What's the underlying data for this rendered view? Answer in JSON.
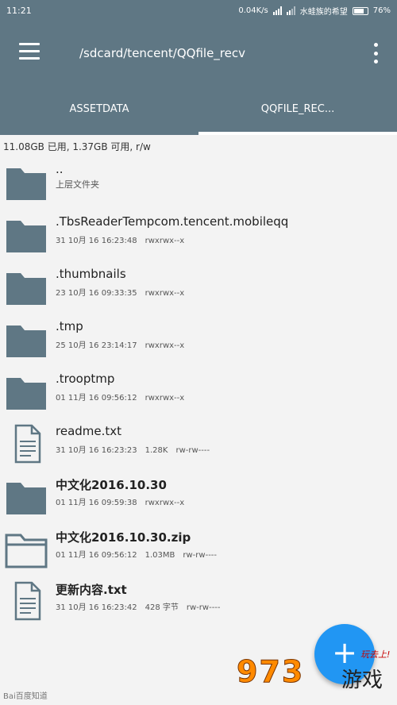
{
  "statusbar": {
    "time": "11:21",
    "net_speed": "0.04K/s",
    "carrier": "水蛙族的希望",
    "battery": "76%"
  },
  "appbar": {
    "path": "/sdcard/tencent/QQfile_recv",
    "menu_icon": "hamburger-menu-icon",
    "more_icon": "more-vert-icon"
  },
  "tabs": [
    {
      "label": "ASSETDATA",
      "active": false
    },
    {
      "label": "QQFILE_REC...",
      "active": true
    }
  ],
  "storage_info": "11.08GB 已用, 1.37GB 可用, r/w",
  "files": [
    {
      "name": "..",
      "type": "folder",
      "subtitle": "上层文件夹"
    },
    {
      "name": ".TbsReaderTempcom.tencent.mobileqq",
      "type": "folder",
      "date": "31 10月 16 16:23:48",
      "size": "",
      "perm": "rwxrwx--x"
    },
    {
      "name": ".thumbnails",
      "type": "folder",
      "date": "23 10月 16 09:33:35",
      "size": "",
      "perm": "rwxrwx--x"
    },
    {
      "name": ".tmp",
      "type": "folder",
      "date": "25 10月 16 23:14:17",
      "size": "",
      "perm": "rwxrwx--x"
    },
    {
      "name": ".trooptmp",
      "type": "folder",
      "date": "01 11月 16 09:56:12",
      "size": "",
      "perm": "rwxrwx--x"
    },
    {
      "name": "readme.txt",
      "type": "file",
      "date": "31 10月 16 16:23:23",
      "size": "1.28K",
      "perm": "rw-rw----"
    },
    {
      "name": "中文化2016.10.30",
      "type": "folder",
      "date": "01 11月 16 09:59:38",
      "size": "",
      "perm": "rwxrwx--x"
    },
    {
      "name": "中文化2016.10.30.zip",
      "type": "archive",
      "date": "01 11月 16 09:56:12",
      "size": "1.03MB",
      "perm": "rw-rw----"
    },
    {
      "name": "更新内容.txt",
      "type": "file",
      "date": "31 10月 16 16:23:42",
      "size": "428 字节",
      "perm": "rw-rw----"
    }
  ],
  "fab": {
    "label": "+"
  },
  "watermark": {
    "left": "Bai百度知道",
    "number": "973",
    "game": "游戏",
    "tag": "玩去上!"
  },
  "colors": {
    "appbar": "#5f7784",
    "folder_icon": "#5f7784",
    "fab": "#2196f3"
  }
}
